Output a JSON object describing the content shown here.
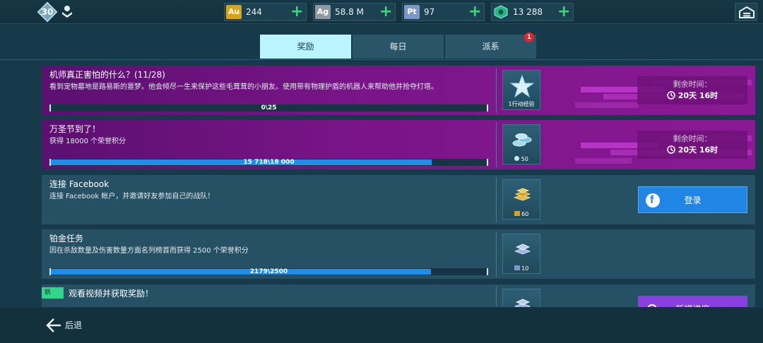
{
  "topbar": {
    "level": "30",
    "currencies": [
      {
        "code": "Au",
        "value": "244",
        "color": "#d9a514"
      },
      {
        "code": "Ag",
        "value": "58.8 M",
        "color": "#8f9aa0"
      },
      {
        "code": "Pt",
        "value": "97",
        "color": "#7d98c7"
      },
      {
        "code": "",
        "value": "13 288",
        "color": "#27b58a"
      }
    ]
  },
  "tabs": [
    {
      "label": "奖励"
    },
    {
      "label": "每日"
    },
    {
      "label": "派系",
      "badge": "1"
    }
  ],
  "cards": [
    {
      "title": "机师真正害怕的什么？(11/28)",
      "desc": "看到宠物墓地是路易斯的噩梦。他会倾尽一生来保护这些毛茸茸的小朋友。使用带有物理护盾的机器人来帮助他并抢夺灯塔。",
      "progress_text": "0\\25",
      "progress": 0,
      "reward_label": "1行动经验",
      "timer_label": "剩余时间：",
      "timer_value": "20天 16时"
    },
    {
      "title": "万圣节到了！",
      "desc": "获得 18000 个荣誉积分",
      "progress_text": "15 718\\18 000",
      "progress": 0.873,
      "reward_label": "50",
      "timer_label": "剩余时间：",
      "timer_value": "20天 16时"
    },
    {
      "title": "连接 Facebook",
      "desc": "连接 Facebook 帐户，并邀请好友参加自己的战队！",
      "reward_label": "60",
      "button_label": "登录"
    },
    {
      "title": "铂金任务",
      "desc": "因在杀敌数量及伤害数量方面名列榜首而获得 2500 个荣誉积分",
      "progress_text": "2179\\2500",
      "progress": 0.872,
      "reward_label": "10"
    },
    {
      "tag": "新",
      "title": "观看视频并获取奖励！",
      "button_label": "新增进度"
    }
  ],
  "bottom": {
    "back_label": "后退"
  }
}
